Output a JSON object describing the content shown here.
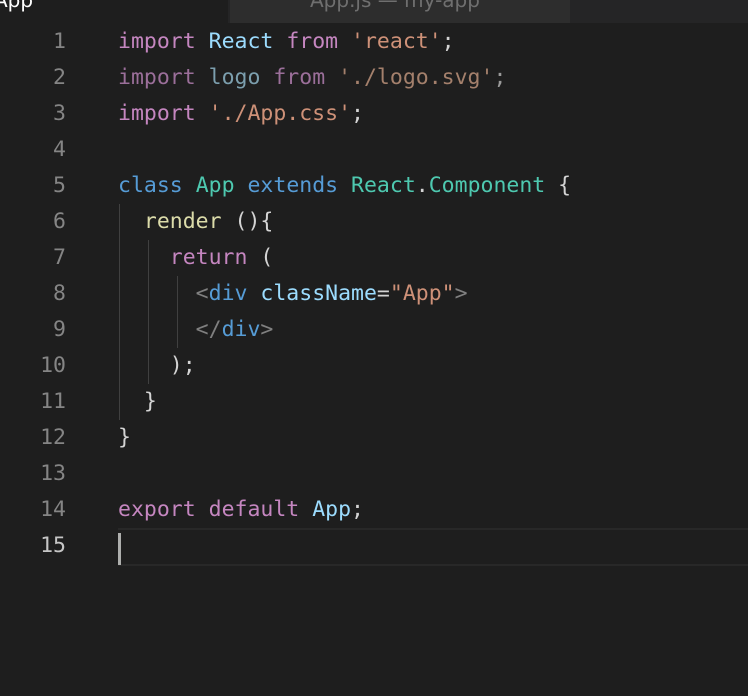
{
  "tabs": {
    "active_label": "App",
    "inactive_label": "App.js — my-app"
  },
  "editor": {
    "lines": [
      {
        "n": "1",
        "tokens": [
          [
            "kw-ctrl",
            "import"
          ],
          [
            "punc",
            " "
          ],
          [
            "var",
            "React"
          ],
          [
            "punc",
            " "
          ],
          [
            "kw-ctrl",
            "from"
          ],
          [
            "punc",
            " "
          ],
          [
            "str",
            "'react'"
          ],
          [
            "punc",
            ";"
          ]
        ]
      },
      {
        "n": "2",
        "tokens": [
          [
            "kw-dim",
            "import"
          ],
          [
            "punc",
            " "
          ],
          [
            "var-dim",
            "logo"
          ],
          [
            "punc",
            " "
          ],
          [
            "kw-dim",
            "from"
          ],
          [
            "punc",
            " "
          ],
          [
            "str-dim",
            "'./logo.svg'"
          ],
          [
            "punc-dim",
            ";"
          ]
        ]
      },
      {
        "n": "3",
        "tokens": [
          [
            "kw-ctrl",
            "import"
          ],
          [
            "punc",
            " "
          ],
          [
            "str",
            "'./App.css'"
          ],
          [
            "punc",
            ";"
          ]
        ]
      },
      {
        "n": "4",
        "tokens": []
      },
      {
        "n": "5",
        "tokens": [
          [
            "kw-blue",
            "class"
          ],
          [
            "punc",
            " "
          ],
          [
            "type",
            "App"
          ],
          [
            "punc",
            " "
          ],
          [
            "kw-blue",
            "extends"
          ],
          [
            "punc",
            " "
          ],
          [
            "type",
            "React"
          ],
          [
            "punc",
            "."
          ],
          [
            "type",
            "Component"
          ],
          [
            "punc",
            " {"
          ]
        ]
      },
      {
        "n": "6",
        "tokens": [
          [
            "punc",
            "  "
          ],
          [
            "fn",
            "render"
          ],
          [
            "punc",
            " (){"
          ]
        ]
      },
      {
        "n": "7",
        "tokens": [
          [
            "punc",
            "    "
          ],
          [
            "kw-ctrl",
            "return"
          ],
          [
            "punc",
            " ("
          ]
        ]
      },
      {
        "n": "8",
        "tokens": [
          [
            "punc",
            "      "
          ],
          [
            "tagp",
            "<"
          ],
          [
            "tag",
            "div"
          ],
          [
            "punc",
            " "
          ],
          [
            "attr",
            "className"
          ],
          [
            "punc",
            "="
          ],
          [
            "str",
            "\"App\""
          ],
          [
            "tagp",
            ">"
          ]
        ]
      },
      {
        "n": "9",
        "tokens": [
          [
            "punc",
            "      "
          ],
          [
            "tagp",
            "</"
          ],
          [
            "tag",
            "div"
          ],
          [
            "tagp",
            ">"
          ]
        ]
      },
      {
        "n": "10",
        "tokens": [
          [
            "punc",
            "    );"
          ]
        ]
      },
      {
        "n": "11",
        "tokens": [
          [
            "punc",
            "  }"
          ]
        ]
      },
      {
        "n": "12",
        "tokens": [
          [
            "punc",
            "}"
          ]
        ]
      },
      {
        "n": "13",
        "tokens": []
      },
      {
        "n": "14",
        "tokens": [
          [
            "kw-ctrl",
            "export"
          ],
          [
            "punc",
            " "
          ],
          [
            "kw-ctrl",
            "default"
          ],
          [
            "punc",
            " "
          ],
          [
            "var",
            "App"
          ],
          [
            "punc",
            ";"
          ]
        ]
      },
      {
        "n": "15",
        "tokens": []
      }
    ],
    "active_line": "15"
  }
}
